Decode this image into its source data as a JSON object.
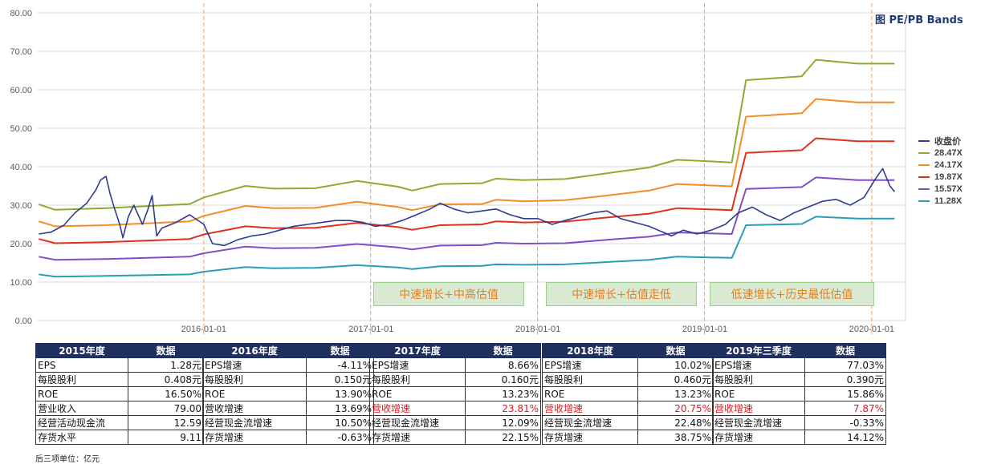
{
  "chart_data": {
    "type": "line",
    "title": "图 PE/PB Bands",
    "y_axis": {
      "ticks": [
        "0.00",
        "10.00",
        "20.00",
        "30.00",
        "40.00",
        "50.00",
        "60.00",
        "70.00",
        "80.00"
      ],
      "ylim": [
        0,
        80
      ]
    },
    "x_axis": {
      "ticks": [
        "2016-01-01",
        "2017-01-01",
        "2018-01-01",
        "2019-01-01",
        "2020-01-01"
      ],
      "xlim": [
        "2015-01-01",
        "2020-03-15"
      ]
    },
    "grid": "horizontal",
    "legend_position": "right",
    "series": [
      {
        "name": "收盘价",
        "color": "#2e3d8f",
        "points": [
          [
            "2015-01-05",
            22.5
          ],
          [
            "2015-02-01",
            23.0
          ],
          [
            "2015-03-01",
            24.8
          ],
          [
            "2015-03-25",
            28.0
          ],
          [
            "2015-04-20",
            30.5
          ],
          [
            "2015-05-10",
            34.0
          ],
          [
            "2015-05-20",
            36.5
          ],
          [
            "2015-06-01",
            37.5
          ],
          [
            "2015-06-10",
            33.0
          ],
          [
            "2015-06-20",
            29.0
          ],
          [
            "2015-07-01",
            25.0
          ],
          [
            "2015-07-08",
            21.5
          ],
          [
            "2015-07-20",
            27.0
          ],
          [
            "2015-08-01",
            30.0
          ],
          [
            "2015-08-20",
            25.0
          ],
          [
            "2015-09-01",
            29.0
          ],
          [
            "2015-09-10",
            32.5
          ],
          [
            "2015-09-20",
            22.0
          ],
          [
            "2015-10-01",
            24.0
          ],
          [
            "2015-11-01",
            25.5
          ],
          [
            "2015-12-01",
            27.5
          ],
          [
            "2016-01-01",
            25.0
          ],
          [
            "2016-01-20",
            20.0
          ],
          [
            "2016-02-15",
            19.5
          ],
          [
            "2016-03-15",
            21.0
          ],
          [
            "2016-04-15",
            22.0
          ],
          [
            "2016-05-15",
            22.5
          ],
          [
            "2016-06-15",
            23.5
          ],
          [
            "2016-07-15",
            24.5
          ],
          [
            "2016-08-15",
            25.0
          ],
          [
            "2016-09-15",
            25.5
          ],
          [
            "2016-10-15",
            26.0
          ],
          [
            "2016-11-15",
            26.0
          ],
          [
            "2016-12-15",
            25.5
          ],
          [
            "2017-01-10",
            24.5
          ],
          [
            "2017-02-10",
            25.0
          ],
          [
            "2017-03-10",
            26.0
          ],
          [
            "2017-04-10",
            27.5
          ],
          [
            "2017-05-10",
            29.0
          ],
          [
            "2017-06-01",
            30.5
          ],
          [
            "2017-07-01",
            29.0
          ],
          [
            "2017-08-01",
            28.0
          ],
          [
            "2017-09-01",
            28.5
          ],
          [
            "2017-10-01",
            29.0
          ],
          [
            "2017-11-01",
            27.5
          ],
          [
            "2017-12-01",
            26.5
          ],
          [
            "2018-01-01",
            26.5
          ],
          [
            "2018-02-01",
            25.0
          ],
          [
            "2018-03-01",
            26.0
          ],
          [
            "2018-04-01",
            27.0
          ],
          [
            "2018-05-01",
            28.0
          ],
          [
            "2018-06-01",
            28.5
          ],
          [
            "2018-07-01",
            26.5
          ],
          [
            "2018-08-01",
            25.5
          ],
          [
            "2018-09-01",
            24.5
          ],
          [
            "2018-10-01",
            23.0
          ],
          [
            "2018-10-20",
            22.0
          ],
          [
            "2018-11-15",
            23.5
          ],
          [
            "2018-12-15",
            22.5
          ],
          [
            "2019-01-15",
            23.5
          ],
          [
            "2019-02-15",
            25.0
          ],
          [
            "2019-03-15",
            28.0
          ],
          [
            "2019-04-15",
            29.5
          ],
          [
            "2019-05-15",
            27.5
          ],
          [
            "2019-06-15",
            26.0
          ],
          [
            "2019-07-15",
            28.0
          ],
          [
            "2019-08-15",
            29.5
          ],
          [
            "2019-09-15",
            31.0
          ],
          [
            "2019-10-15",
            31.5
          ],
          [
            "2019-11-15",
            30.0
          ],
          [
            "2019-12-15",
            32.0
          ],
          [
            "2020-01-10",
            37.0
          ],
          [
            "2020-01-25",
            39.5
          ],
          [
            "2020-02-10",
            35.0
          ],
          [
            "2020-02-20",
            33.5
          ]
        ]
      },
      {
        "name": "28.47X",
        "color": "#8cad2e",
        "points": [
          [
            "2015-01-05",
            30.2
          ],
          [
            "2015-02-10",
            28.8
          ],
          [
            "2015-06-01",
            29.2
          ],
          [
            "2015-12-01",
            30.3
          ],
          [
            "2016-01-01",
            32.0
          ],
          [
            "2016-04-01",
            35.0
          ],
          [
            "2016-06-01",
            34.3
          ],
          [
            "2016-09-01",
            34.4
          ],
          [
            "2016-12-01",
            36.3
          ],
          [
            "2017-03-01",
            34.8
          ],
          [
            "2017-04-01",
            33.8
          ],
          [
            "2017-06-01",
            35.5
          ],
          [
            "2017-09-01",
            35.7
          ],
          [
            "2017-10-01",
            36.9
          ],
          [
            "2017-12-01",
            36.5
          ],
          [
            "2018-03-01",
            36.8
          ],
          [
            "2018-06-01",
            38.3
          ],
          [
            "2018-09-01",
            39.8
          ],
          [
            "2018-11-01",
            41.8
          ],
          [
            "2019-03-01",
            41.1
          ],
          [
            "2019-04-01",
            62.5
          ],
          [
            "2019-08-01",
            63.5
          ],
          [
            "2019-09-01",
            67.8
          ],
          [
            "2019-12-01",
            66.8
          ],
          [
            "2020-02-20",
            66.8
          ]
        ]
      },
      {
        "name": "24.17X",
        "color": "#f28e26",
        "points": [
          [
            "2015-01-05",
            25.8
          ],
          [
            "2015-02-10",
            24.5
          ],
          [
            "2015-06-01",
            24.8
          ],
          [
            "2015-12-01",
            25.8
          ],
          [
            "2016-01-01",
            27.2
          ],
          [
            "2016-04-01",
            29.8
          ],
          [
            "2016-06-01",
            29.2
          ],
          [
            "2016-09-01",
            29.3
          ],
          [
            "2016-12-01",
            30.9
          ],
          [
            "2017-03-01",
            29.5
          ],
          [
            "2017-04-01",
            28.7
          ],
          [
            "2017-06-01",
            30.2
          ],
          [
            "2017-09-01",
            30.3
          ],
          [
            "2017-10-01",
            31.4
          ],
          [
            "2017-12-01",
            31.0
          ],
          [
            "2018-03-01",
            31.3
          ],
          [
            "2018-06-01",
            32.5
          ],
          [
            "2018-09-01",
            33.8
          ],
          [
            "2018-11-01",
            35.5
          ],
          [
            "2019-03-01",
            34.9
          ],
          [
            "2019-04-01",
            53.0
          ],
          [
            "2019-08-01",
            53.9
          ],
          [
            "2019-09-01",
            57.6
          ],
          [
            "2019-12-01",
            56.7
          ],
          [
            "2020-02-20",
            56.7
          ]
        ]
      },
      {
        "name": "19.87X",
        "color": "#e0301e",
        "points": [
          [
            "2015-01-05",
            21.2
          ],
          [
            "2015-02-10",
            20.1
          ],
          [
            "2015-06-01",
            20.4
          ],
          [
            "2015-12-01",
            21.2
          ],
          [
            "2016-01-01",
            22.4
          ],
          [
            "2016-04-01",
            24.5
          ],
          [
            "2016-06-01",
            24.0
          ],
          [
            "2016-09-01",
            24.1
          ],
          [
            "2016-12-01",
            25.4
          ],
          [
            "2017-03-01",
            24.3
          ],
          [
            "2017-04-01",
            23.6
          ],
          [
            "2017-06-01",
            24.8
          ],
          [
            "2017-09-01",
            25.0
          ],
          [
            "2017-10-01",
            25.8
          ],
          [
            "2017-12-01",
            25.5
          ],
          [
            "2018-03-01",
            25.7
          ],
          [
            "2018-06-01",
            26.8
          ],
          [
            "2018-09-01",
            27.8
          ],
          [
            "2018-11-01",
            29.2
          ],
          [
            "2019-03-01",
            28.7
          ],
          [
            "2019-04-01",
            43.6
          ],
          [
            "2019-08-01",
            44.3
          ],
          [
            "2019-09-01",
            47.4
          ],
          [
            "2019-12-01",
            46.6
          ],
          [
            "2020-02-20",
            46.6
          ]
        ]
      },
      {
        "name": "15.57X",
        "color": "#7f4fc9",
        "points": [
          [
            "2015-01-05",
            16.6
          ],
          [
            "2015-02-10",
            15.8
          ],
          [
            "2015-06-01",
            16.0
          ],
          [
            "2015-12-01",
            16.6
          ],
          [
            "2016-01-01",
            17.5
          ],
          [
            "2016-04-01",
            19.2
          ],
          [
            "2016-06-01",
            18.8
          ],
          [
            "2016-09-01",
            18.9
          ],
          [
            "2016-12-01",
            19.9
          ],
          [
            "2017-03-01",
            19.0
          ],
          [
            "2017-04-01",
            18.5
          ],
          [
            "2017-06-01",
            19.5
          ],
          [
            "2017-09-01",
            19.6
          ],
          [
            "2017-10-01",
            20.2
          ],
          [
            "2017-12-01",
            20.0
          ],
          [
            "2018-03-01",
            20.1
          ],
          [
            "2018-06-01",
            21.0
          ],
          [
            "2018-09-01",
            21.8
          ],
          [
            "2018-11-01",
            22.9
          ],
          [
            "2019-03-01",
            22.5
          ],
          [
            "2019-04-01",
            34.2
          ],
          [
            "2019-08-01",
            34.7
          ],
          [
            "2019-09-01",
            37.2
          ],
          [
            "2019-12-01",
            36.5
          ],
          [
            "2020-02-20",
            36.5
          ]
        ]
      },
      {
        "name": "11.28X",
        "color": "#2a9cb8",
        "points": [
          [
            "2015-01-05",
            12.0
          ],
          [
            "2015-02-10",
            11.4
          ],
          [
            "2015-06-01",
            11.6
          ],
          [
            "2015-12-01",
            12.0
          ],
          [
            "2016-01-01",
            12.7
          ],
          [
            "2016-04-01",
            13.9
          ],
          [
            "2016-06-01",
            13.6
          ],
          [
            "2016-09-01",
            13.7
          ],
          [
            "2016-12-01",
            14.4
          ],
          [
            "2017-03-01",
            13.8
          ],
          [
            "2017-04-01",
            13.4
          ],
          [
            "2017-06-01",
            14.1
          ],
          [
            "2017-09-01",
            14.2
          ],
          [
            "2017-10-01",
            14.6
          ],
          [
            "2017-12-01",
            14.5
          ],
          [
            "2018-03-01",
            14.6
          ],
          [
            "2018-06-01",
            15.2
          ],
          [
            "2018-09-01",
            15.8
          ],
          [
            "2018-11-01",
            16.6
          ],
          [
            "2019-03-01",
            16.3
          ],
          [
            "2019-04-01",
            24.8
          ],
          [
            "2019-08-01",
            25.1
          ],
          [
            "2019-09-01",
            27.0
          ],
          [
            "2019-12-01",
            26.5
          ],
          [
            "2020-02-20",
            26.5
          ]
        ]
      }
    ],
    "dividers": [
      "2016-01-01",
      "2016-12-31",
      "2017-12-31",
      "2018-12-31",
      "2020-01-01"
    ],
    "annotations": [
      {
        "text": "中速增长+中高估值"
      },
      {
        "text": "中速增长+估值走低"
      },
      {
        "text": "低速增长+历史最低估值"
      }
    ]
  },
  "tables": [
    {
      "header": [
        "2015年度",
        "数据"
      ],
      "rows": [
        [
          "EPS",
          "1.28元"
        ],
        [
          "每股股利",
          "0.408元"
        ],
        [
          "ROE",
          "16.50%"
        ],
        [
          "营业收入",
          "79.00"
        ],
        [
          "经营活动现金流",
          "12.59"
        ],
        [
          "存货水平",
          "9.11"
        ]
      ],
      "highlight_row": -1
    },
    {
      "header": [
        "2016年度",
        "数据"
      ],
      "rows": [
        [
          "EPS增速",
          "-4.11%"
        ],
        [
          "每股股利",
          "0.150元"
        ],
        [
          "ROE",
          "13.90%"
        ],
        [
          "营收增速",
          "13.69%"
        ],
        [
          "经营现金流增速",
          "10.50%"
        ],
        [
          "存货增速",
          "-0.63%"
        ]
      ],
      "highlight_row": -1
    },
    {
      "header": [
        "2017年度",
        "数据"
      ],
      "rows": [
        [
          "EPS增速",
          "8.66%"
        ],
        [
          "每股股利",
          "0.160元"
        ],
        [
          "ROE",
          "13.23%"
        ],
        [
          "营收增速",
          "23.81%"
        ],
        [
          "经营现金流增速",
          "12.09%"
        ],
        [
          "存货增速",
          "22.15%"
        ]
      ],
      "highlight_row": 3
    },
    {
      "header": [
        "2018年度",
        "数据"
      ],
      "rows": [
        [
          "EPS增速",
          "10.02%"
        ],
        [
          "每股股利",
          "0.460元"
        ],
        [
          "ROE",
          "13.23%"
        ],
        [
          "营收增速",
          "20.75%"
        ],
        [
          "经营现金流增速",
          "22.48%"
        ],
        [
          "存货增速",
          "38.75%"
        ]
      ],
      "highlight_row": 3
    },
    {
      "header": [
        "2019年三季度",
        "数据"
      ],
      "rows": [
        [
          "EPS增速",
          "77.03%"
        ],
        [
          "每股股利",
          "0.390元"
        ],
        [
          "ROE",
          "15.86%"
        ],
        [
          "营收增速",
          "7.87%"
        ],
        [
          "经营现金流增速",
          "-0.33%"
        ],
        [
          "存货增速",
          "14.12%"
        ]
      ],
      "highlight_row": 3
    }
  ],
  "footnote": "后三项单位：亿元",
  "colors": {
    "highlight": "#e0191d",
    "table_header": "#1f2f5e",
    "divider": "#f0a060"
  }
}
